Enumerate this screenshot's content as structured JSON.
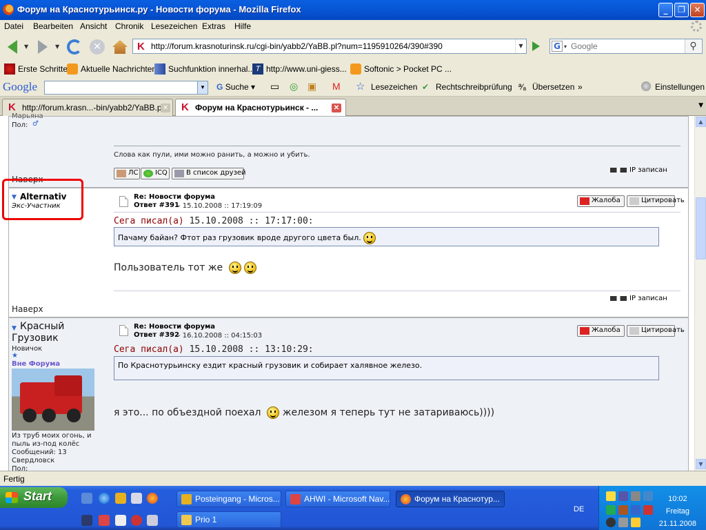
{
  "window": {
    "title": "Форум на Краснотурьинск.ру - Новости форума - Mozilla Firefox"
  },
  "menu": [
    "Datei",
    "Bearbeiten",
    "Ansicht",
    "Chronik",
    "Lesezeichen",
    "Extras",
    "Hilfe"
  ],
  "nav": {
    "url": "http://forum.krasnoturinsk.ru/cgi-bin/yabb2/YaBB.pl?num=1195910264/390#390",
    "search_placeholder": "Google"
  },
  "bookmarks": [
    "Erste Schritte",
    "Aktuelle Nachrichten",
    "Suchfunktion innerhal...",
    "http://www.uni-giess...",
    "Softonic > Pocket PC ..."
  ],
  "google_toolbar": {
    "logo": "Google",
    "suche": "Suche",
    "lesezeichen": "Lesezeichen",
    "rechtschreib": "Rechtschreibprüfung",
    "uebersetzen": "Übersetzen",
    "more": "»",
    "einstellungen": "Einstellungen"
  },
  "tabs": [
    {
      "title": "http://forum.krasn...-bin/yabb2/YaBB.pl",
      "active": false
    },
    {
      "title": "Форум на Краснотурьинск - ...",
      "active": true
    }
  ],
  "prev_post": {
    "user_tail": "Марьяна",
    "gender": "Пол:",
    "signature": "Слова как пули, ими можно ранить, а можно и убить.",
    "buttons": [
      "ЛС",
      "ICQ",
      "В список друзей"
    ],
    "ip": "IP записан",
    "top": "Наверх"
  },
  "post391": {
    "user": "Alternativ",
    "rank": "Экс-Участник",
    "subject": "Re: Новости форума",
    "reply": "Ответ #391",
    "date": "15.10.2008 :: 17:19:09",
    "report": "Жалоба",
    "quote_btn": "Цитировать",
    "quote_author": "Сега писал(а)",
    "quote_date": "15.10.2008 :: 17:17:00:",
    "quote_text": "Пачаму байан? Фтот раз грузовик вроде другого цвета был.",
    "body": "Пользователь тот же",
    "ip": "IP записан",
    "top": "Наверх"
  },
  "post392": {
    "user_line1": "Красный",
    "user_line2": "Грузовик",
    "rank": "Новичок",
    "star": "★",
    "status": "Вне Форума",
    "sig1": "Из труб моих огонь, и",
    "sig2": "пыль из-под колёс",
    "posts": "Сообщений: 13",
    "city": "Свердловск",
    "gender": "Пол:",
    "subject": "Re: Новости форума",
    "reply": "Ответ #392",
    "date": "16.10.2008 :: 04:15:03",
    "report": "Жалоба",
    "quote_btn": "Цитировать",
    "quote_author": "Сега писал(а)",
    "quote_date": "15.10.2008 :: 13:10:29:",
    "quote_text": "По Краснотурьинску ездит красный грузовик и собирает халявное железо.",
    "body_a": "я это... по объездной поехал",
    "body_b": "железом я теперь тут не затариваюсь))))"
  },
  "status": "Fertig",
  "taskbar": {
    "start": "Start",
    "tasks": [
      "Posteingang - Micros...",
      "AHWI - Microsoft Nav...",
      "Форум на Краснотур...",
      "Prio 1"
    ],
    "lang": "DE",
    "time": "10:02",
    "day": "Freitag",
    "date": "21.11.2008"
  },
  "colors": {
    "accent_red": "#8b0000",
    "highlight_box": "#ee0000",
    "xp_blue": "#245edc"
  }
}
